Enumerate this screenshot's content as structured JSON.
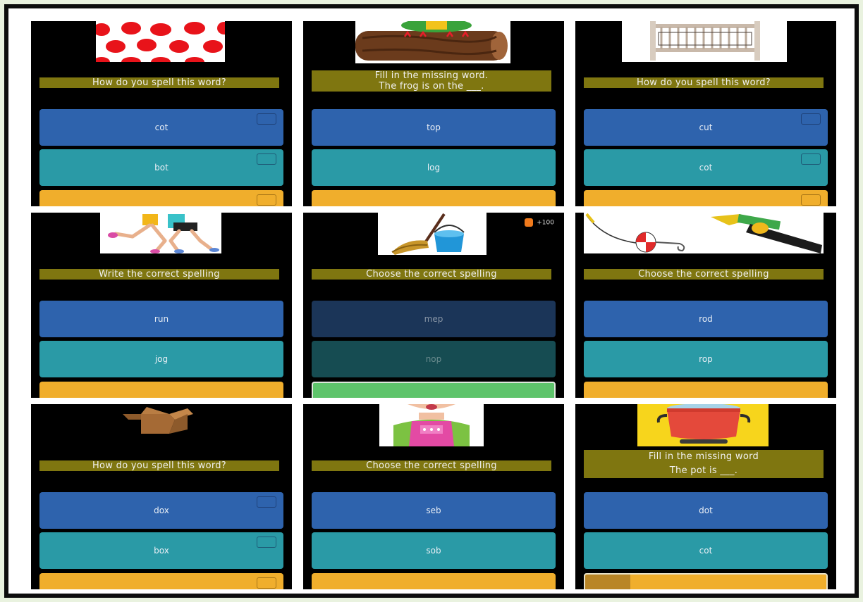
{
  "panels": [
    {
      "id": "p1",
      "image_icon": "polka-dot-pattern-icon",
      "prompt": [
        "How do you spell this word?"
      ],
      "options": [
        "cot",
        "bot",
        ""
      ]
    },
    {
      "id": "p2",
      "image_icon": "frog-on-log-icon",
      "prompt": [
        "Fill in the missing word.",
        "The frog is on the ___."
      ],
      "options": [
        "top",
        "log",
        ""
      ]
    },
    {
      "id": "p3",
      "image_icon": "crib-icon",
      "prompt": [
        "How do you spell this word?"
      ],
      "options": [
        "cut",
        "cot",
        ""
      ]
    },
    {
      "id": "p4",
      "image_icon": "runners-icon",
      "prompt": [
        "Write the correct spelling"
      ],
      "options": [
        "run",
        "jog",
        ""
      ]
    },
    {
      "id": "p5",
      "image_icon": "mop-bucket-icon",
      "prompt": [
        "Choose the correct spelling"
      ],
      "options": [
        "mep",
        "nop",
        ""
      ],
      "coins": "+100"
    },
    {
      "id": "p6",
      "image_icon": "fishing-rod-icon",
      "prompt": [
        "Choose the correct spelling"
      ],
      "options": [
        "rod",
        "rop",
        ""
      ]
    },
    {
      "id": "p7",
      "image_icon": "cardboard-box-icon",
      "prompt": [
        "How do you spell this word?"
      ],
      "options": [
        "dox",
        "box",
        ""
      ]
    },
    {
      "id": "p8",
      "image_icon": "girl-sobbing-icon",
      "prompt": [
        "Choose the correct spelling"
      ],
      "options": [
        "seb",
        "sob",
        ""
      ]
    },
    {
      "id": "p9",
      "image_icon": "pot-icon",
      "prompt": [
        "Fill in the missing word",
        "The pot is ___."
      ],
      "options": [
        "dot",
        "cot",
        ""
      ]
    }
  ],
  "colors": {
    "prompt_bg": "#7f7610",
    "option_blue": "#2e63ad",
    "option_teal": "#2a9aa6",
    "option_yellow": "#f0ae2c",
    "option_green": "#5ec46b"
  }
}
